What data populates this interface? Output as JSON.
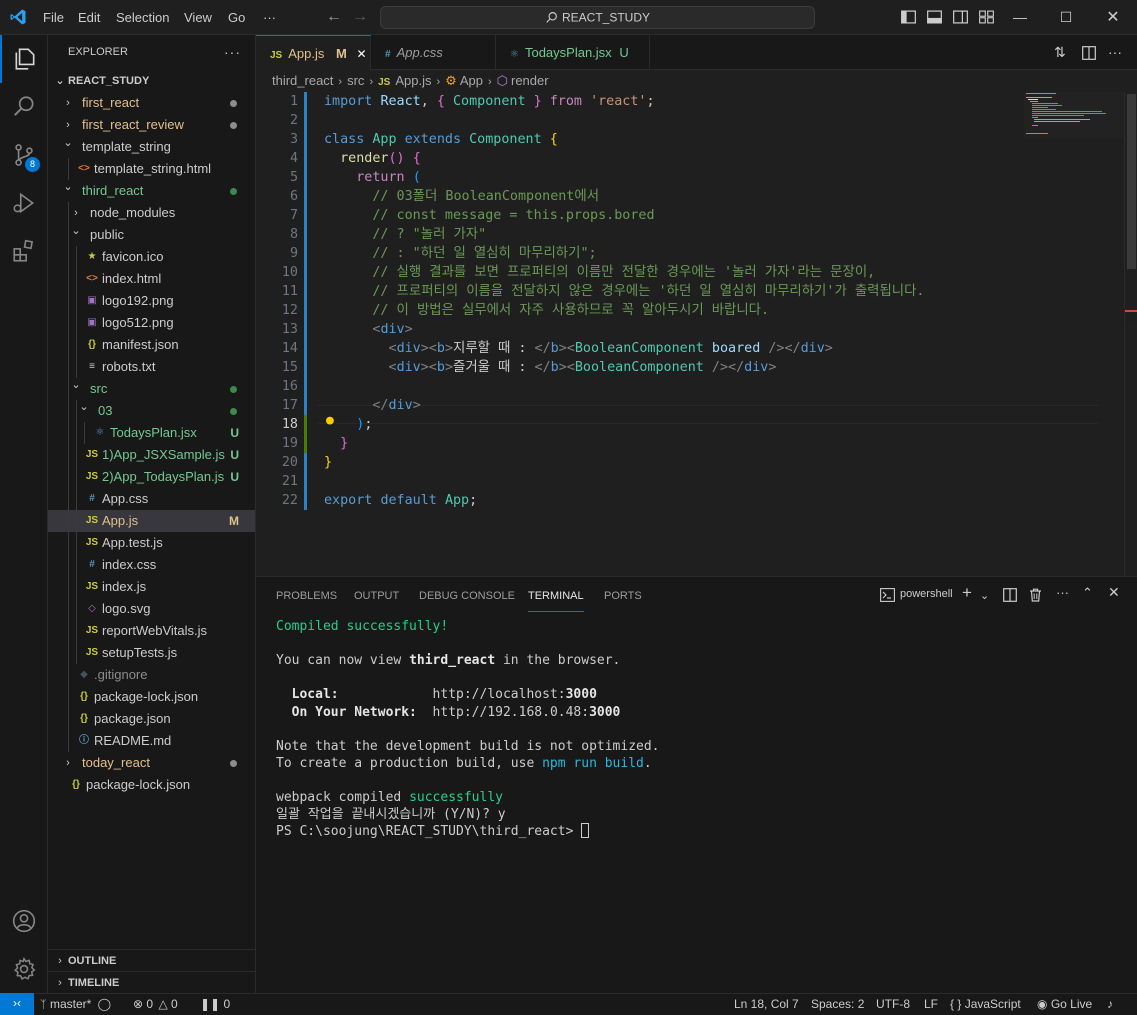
{
  "titlebar": {
    "menu": [
      "File",
      "Edit",
      "Selection",
      "View",
      "Go"
    ],
    "more": "···",
    "search": "REACT_STUDY"
  },
  "activity_badge": "8",
  "explorer": {
    "title": "EXPLORER",
    "more": "···",
    "root": "REACT_STUDY",
    "items": [
      {
        "label": "first_react",
        "icon": "chevron-right",
        "dot": "#8d8d8d"
      },
      {
        "label": "first_react_review",
        "icon": "chevron-right",
        "dot": "#8d8d8d"
      },
      {
        "label": "template_string",
        "icon": "chevron-down"
      },
      {
        "label": "template_string.html",
        "icon": "html"
      },
      {
        "label": "third_react",
        "icon": "chevron-down",
        "dot": "#3a8b4d"
      },
      {
        "label": "node_modules",
        "icon": "chevron-right"
      },
      {
        "label": "public",
        "icon": "chevron-down"
      },
      {
        "label": "favicon.ico",
        "icon": "star"
      },
      {
        "label": "index.html",
        "icon": "html"
      },
      {
        "label": "logo192.png",
        "icon": "image"
      },
      {
        "label": "logo512.png",
        "icon": "image"
      },
      {
        "label": "manifest.json",
        "icon": "json"
      },
      {
        "label": "robots.txt",
        "icon": "text"
      },
      {
        "label": "src",
        "icon": "chevron-down",
        "dot": "#3a8b4d"
      },
      {
        "label": "03",
        "icon": "chevron-down",
        "dot": "#3a8b4d"
      },
      {
        "label": "TodaysPlan.jsx",
        "icon": "react",
        "deco": "U"
      },
      {
        "label": "1)App_JSXSample.js",
        "icon": "js",
        "deco": "U"
      },
      {
        "label": "2)App_TodaysPlan.js",
        "icon": "js",
        "deco": "U"
      },
      {
        "label": "App.css",
        "icon": "css"
      },
      {
        "label": "App.js",
        "icon": "js",
        "deco": "M"
      },
      {
        "label": "App.test.js",
        "icon": "js"
      },
      {
        "label": "index.css",
        "icon": "css"
      },
      {
        "label": "index.js",
        "icon": "js"
      },
      {
        "label": "logo.svg",
        "icon": "svg"
      },
      {
        "label": "reportWebVitals.js",
        "icon": "js"
      },
      {
        "label": "setupTests.js",
        "icon": "js"
      },
      {
        "label": ".gitignore",
        "icon": "git"
      },
      {
        "label": "package-lock.json",
        "icon": "json"
      },
      {
        "label": "package.json",
        "icon": "json"
      },
      {
        "label": "README.md",
        "icon": "info"
      },
      {
        "label": "today_react",
        "icon": "chevron-right",
        "dot": "#8d8d8d"
      },
      {
        "label": "package-lock.json",
        "icon": "json"
      }
    ],
    "outline": "OUTLINE",
    "timeline": "TIMELINE"
  },
  "tabs": [
    {
      "label": "App.js",
      "icon_text": "JS",
      "deco": "M",
      "close": "✕"
    },
    {
      "label": "App.css",
      "icon_text": "#"
    },
    {
      "label": "TodaysPlan.jsx",
      "icon_text": "⚛",
      "deco": "U"
    }
  ],
  "breadcrumb": [
    "third_react",
    "src",
    "App.js",
    "App",
    "render"
  ],
  "breadcrumb_icons": {
    "js": "JS"
  },
  "editor": {
    "cursor_line": 18,
    "lines": [
      {
        "n": "1",
        "tokens": [
          [
            "k",
            "import"
          ],
          [
            "p",
            " "
          ],
          [
            "v",
            "React"
          ],
          [
            "p",
            ", "
          ],
          [
            "b2",
            "{"
          ],
          [
            "p",
            " "
          ],
          [
            "t",
            "Component"
          ],
          [
            "p",
            " "
          ],
          [
            "b2",
            "}"
          ],
          [
            "p",
            " "
          ],
          [
            "kc",
            "from"
          ],
          [
            "p",
            " "
          ],
          [
            "s",
            "'react'"
          ],
          [
            "p",
            ";"
          ]
        ]
      },
      {
        "n": "2",
        "tokens": []
      },
      {
        "n": "3",
        "tokens": [
          [
            "k",
            "class"
          ],
          [
            "p",
            " "
          ],
          [
            "t",
            "App"
          ],
          [
            "p",
            " "
          ],
          [
            "k",
            "extends"
          ],
          [
            "p",
            " "
          ],
          [
            "t",
            "Component"
          ],
          [
            "p",
            " "
          ],
          [
            "b1",
            "{"
          ]
        ]
      },
      {
        "n": "4",
        "tokens": [
          [
            "p",
            "  "
          ],
          [
            "f",
            "render"
          ],
          [
            "b2",
            "()"
          ],
          [
            "p",
            " "
          ],
          [
            "b2",
            "{"
          ]
        ]
      },
      {
        "n": "5",
        "tokens": [
          [
            "p",
            "    "
          ],
          [
            "kc",
            "return"
          ],
          [
            "p",
            " "
          ],
          [
            "b3",
            "("
          ]
        ]
      },
      {
        "n": "6",
        "tokens": [
          [
            "p",
            "      "
          ],
          [
            "c",
            "// 03폴더 BooleanComponent에서"
          ]
        ]
      },
      {
        "n": "7",
        "tokens": [
          [
            "p",
            "      "
          ],
          [
            "c",
            "// const message = this.props.bored"
          ]
        ]
      },
      {
        "n": "8",
        "tokens": [
          [
            "p",
            "      "
          ],
          [
            "c",
            "// ? \"놀러 가자\""
          ]
        ]
      },
      {
        "n": "9",
        "tokens": [
          [
            "p",
            "      "
          ],
          [
            "c",
            "// : \"하던 일 열심히 마무리하기\";"
          ]
        ]
      },
      {
        "n": "10",
        "tokens": [
          [
            "p",
            "      "
          ],
          [
            "c",
            "// 실행 결과를 보면 프로퍼티의 이름만 전달한 경우에는 '놀러 가자'라는 문장이,"
          ]
        ]
      },
      {
        "n": "11",
        "tokens": [
          [
            "p",
            "      "
          ],
          [
            "c",
            "// 프로퍼티의 이름을 전달하지 않은 경우에는 '하던 일 열심히 마무리하기'가 출력됩니다."
          ]
        ]
      },
      {
        "n": "12",
        "tokens": [
          [
            "p",
            "      "
          ],
          [
            "c",
            "// 이 방법은 실무에서 자주 사용하므로 꼭 알아두시기 바랍니다."
          ]
        ]
      },
      {
        "n": "13",
        "tokens": [
          [
            "p",
            "      "
          ],
          [
            "tg",
            "<"
          ],
          [
            "k",
            "div"
          ],
          [
            "tg",
            ">"
          ]
        ]
      },
      {
        "n": "14",
        "tokens": [
          [
            "p",
            "        "
          ],
          [
            "tg",
            "<"
          ],
          [
            "k",
            "div"
          ],
          [
            "tg",
            "><"
          ],
          [
            "k",
            "b"
          ],
          [
            "tg",
            ">"
          ],
          [
            "p",
            "지루할 때 : "
          ],
          [
            "tg",
            "</"
          ],
          [
            "k",
            "b"
          ],
          [
            "tg",
            "><"
          ],
          [
            "t",
            "BooleanComponent"
          ],
          [
            "p",
            " "
          ],
          [
            "v",
            "boared"
          ],
          [
            "p",
            " "
          ],
          [
            "tg",
            "/></"
          ],
          [
            "k",
            "div"
          ],
          [
            "tg",
            ">"
          ]
        ]
      },
      {
        "n": "15",
        "tokens": [
          [
            "p",
            "        "
          ],
          [
            "tg",
            "<"
          ],
          [
            "k",
            "div"
          ],
          [
            "tg",
            "><"
          ],
          [
            "k",
            "b"
          ],
          [
            "tg",
            ">"
          ],
          [
            "p",
            "즐거울 때 : "
          ],
          [
            "tg",
            "</"
          ],
          [
            "k",
            "b"
          ],
          [
            "tg",
            "><"
          ],
          [
            "t",
            "BooleanComponent"
          ],
          [
            "p",
            " "
          ],
          [
            "tg",
            "/></"
          ],
          [
            "k",
            "div"
          ],
          [
            "tg",
            ">"
          ]
        ]
      },
      {
        "n": "16",
        "tokens": []
      },
      {
        "n": "17",
        "tokens": [
          [
            "p",
            "      "
          ],
          [
            "tg",
            "</"
          ],
          [
            "k",
            "div"
          ],
          [
            "tg",
            ">"
          ]
        ]
      },
      {
        "n": "18",
        "tokens": [
          [
            "p",
            "    "
          ],
          [
            "b3",
            ")"
          ],
          [
            "p",
            ";"
          ]
        ]
      },
      {
        "n": "19",
        "tokens": [
          [
            "p",
            "  "
          ],
          [
            "b2",
            "}"
          ]
        ]
      },
      {
        "n": "20",
        "tokens": [
          [
            "b1",
            "}"
          ]
        ]
      },
      {
        "n": "21",
        "tokens": []
      },
      {
        "n": "22",
        "tokens": [
          [
            "k",
            "export"
          ],
          [
            "p",
            " "
          ],
          [
            "k",
            "default"
          ],
          [
            "p",
            " "
          ],
          [
            "t",
            "App"
          ],
          [
            "p",
            ";"
          ]
        ]
      }
    ]
  },
  "panel": {
    "tabs": [
      "PROBLEMS",
      "OUTPUT",
      "DEBUG CONSOLE",
      "TERMINAL",
      "PORTS"
    ],
    "active_tab": "TERMINAL",
    "shell": "powershell",
    "terminal": [
      [
        [
          "tgreen",
          "Compiled successfully!"
        ]
      ],
      [],
      [
        [
          "p",
          "You can now view "
        ],
        [
          "tb",
          "third_react"
        ],
        [
          "p",
          " in the browser."
        ]
      ],
      [],
      [
        [
          "tb",
          "  Local:"
        ],
        [
          "p",
          "            http://localhost:"
        ],
        [
          "tb",
          "3000"
        ]
      ],
      [
        [
          "tb",
          "  On Your Network:"
        ],
        [
          "p",
          "  http://192.168.0.48:"
        ],
        [
          "tb",
          "3000"
        ]
      ],
      [],
      [
        [
          "p",
          "Note that the development build is not optimized."
        ]
      ],
      [
        [
          "p",
          "To create a production build, use "
        ],
        [
          "tcyan",
          "npm run build"
        ],
        [
          "p",
          "."
        ]
      ],
      [],
      [
        [
          "p",
          "webpack compiled "
        ],
        [
          "tgreen",
          "successfully"
        ]
      ],
      [
        [
          "p",
          "일괄 작업을 끝내시겠습니까 (Y/N)? y"
        ]
      ],
      [
        [
          "p",
          "PS C:\\soojung\\REACT_STUDY\\third_react> "
        ]
      ]
    ]
  },
  "statusbar": {
    "branch": "master*",
    "errors": "0",
    "warnings": "0",
    "ports": "0",
    "position": "Ln 18, Col 7",
    "spaces": "Spaces: 2",
    "encoding": "UTF-8",
    "eol": "LF",
    "language": "JavaScript",
    "golive": "Go Live"
  }
}
